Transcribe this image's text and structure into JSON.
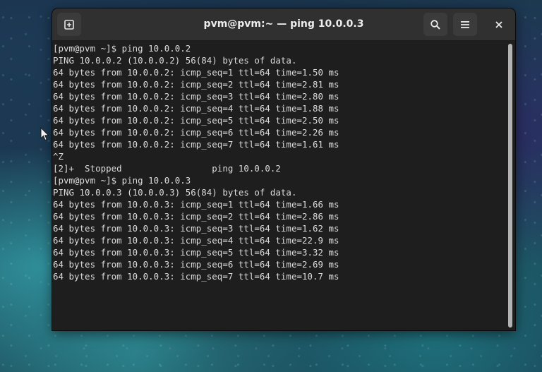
{
  "window": {
    "title": "pvm@pvm:~ — ping 10.0.0.3"
  },
  "header": {
    "buttons": [
      {
        "name": "new-tab",
        "icon": "new-tab-icon"
      },
      {
        "name": "search",
        "icon": "search-icon"
      },
      {
        "name": "menu",
        "icon": "hamburger-menu-icon"
      },
      {
        "name": "close",
        "icon": "close-icon"
      }
    ]
  },
  "terminal": {
    "lines": [
      "[pvm@pvm ~]$ ping 10.0.0.2",
      "PING 10.0.0.2 (10.0.0.2) 56(84) bytes of data.",
      "64 bytes from 10.0.0.2: icmp_seq=1 ttl=64 time=1.50 ms",
      "64 bytes from 10.0.0.2: icmp_seq=2 ttl=64 time=2.81 ms",
      "64 bytes from 10.0.0.2: icmp_seq=3 ttl=64 time=2.80 ms",
      "64 bytes from 10.0.0.2: icmp_seq=4 ttl=64 time=1.88 ms",
      "64 bytes from 10.0.0.2: icmp_seq=5 ttl=64 time=2.50 ms",
      "64 bytes from 10.0.0.2: icmp_seq=6 ttl=64 time=2.26 ms",
      "64 bytes from 10.0.0.2: icmp_seq=7 ttl=64 time=1.61 ms",
      "^Z",
      "[2]+  Stopped                 ping 10.0.0.2",
      "[pvm@pvm ~]$ ping 10.0.0.3",
      "PING 10.0.0.3 (10.0.0.3) 56(84) bytes of data.",
      "64 bytes from 10.0.0.3: icmp_seq=1 ttl=64 time=1.66 ms",
      "64 bytes from 10.0.0.3: icmp_seq=2 ttl=64 time=2.86 ms",
      "64 bytes from 10.0.0.3: icmp_seq=3 ttl=64 time=1.62 ms",
      "64 bytes from 10.0.0.3: icmp_seq=4 ttl=64 time=22.9 ms",
      "64 bytes from 10.0.0.3: icmp_seq=5 ttl=64 time=3.32 ms",
      "64 bytes from 10.0.0.3: icmp_seq=6 ttl=64 time=2.69 ms",
      "64 bytes from 10.0.0.3: icmp_seq=7 ttl=64 time=10.7 ms"
    ]
  },
  "colors": {
    "terminal_bg": "#1e1e1e",
    "terminal_fg": "#dcdcdc",
    "header_bg": "#303030",
    "button_bg": "#3b3b3b",
    "scrollbar_thumb": "#b3b3b3"
  }
}
